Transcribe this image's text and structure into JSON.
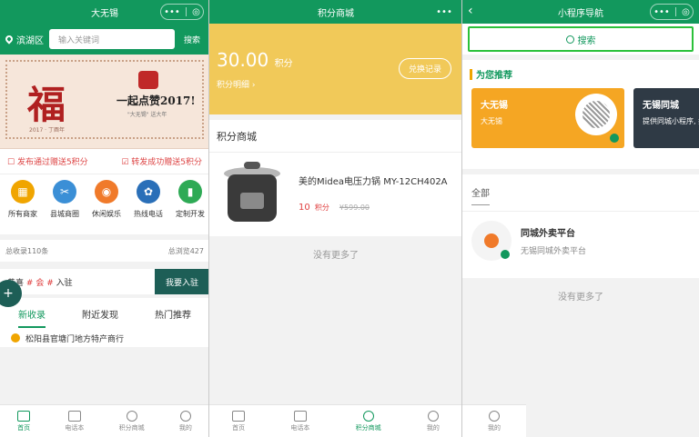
{
  "panel1": {
    "title": "大无锡",
    "location": "滨湖区",
    "search_placeholder": "输入关键词",
    "search_button": "搜索",
    "banner": {
      "fu": "福",
      "fu_sub": "2017 · 丁酉年",
      "slogan": "一起点赞2017!",
      "slogan_sub": "\"大无锡\" 送大年"
    },
    "promo_left": "发布通过赠送5积分",
    "promo_right": "转发成功赠送5积分",
    "categories": [
      {
        "label": "所有商家",
        "color": "#f0a500",
        "glyph": "▦"
      },
      {
        "label": "县城商圈",
        "color": "#3b8fd6",
        "glyph": "✂"
      },
      {
        "label": "休闲娱乐",
        "color": "#f07a2a",
        "glyph": "◉"
      },
      {
        "label": "热线电话",
        "color": "#2a6fb8",
        "glyph": "✿"
      },
      {
        "label": "定制开发",
        "color": "#2eaa55",
        "glyph": "▮"
      }
    ],
    "stats_left": "总收录110条",
    "stats_right": "总浏览427",
    "announce": {
      "pre": "恭喜",
      "hash1": "#",
      "mid": "会",
      "hash2": "#",
      "post": "入驻"
    },
    "announce_button": "我要入驻",
    "tabs": [
      "新收录",
      "附近发现",
      "热门推荐"
    ],
    "list_peek": "松阳县官塘门地方特产商行",
    "tabbar": [
      "首页",
      "电话本",
      "积分商城",
      "我的"
    ]
  },
  "panel2": {
    "title": "积分商城",
    "points_value": "30.00",
    "points_unit": "积分",
    "points_detail": "积分明细",
    "exchange_button": "兑换记录",
    "mall_title": "积分商城",
    "product": {
      "name": "美的Midea电压力锅 MY-12CH402A",
      "price": "10",
      "price_unit": "积分",
      "original": "¥599.00"
    },
    "no_more": "没有更多了",
    "tabbar": [
      "首页",
      "电话本",
      "积分商城",
      "我的"
    ]
  },
  "panel3": {
    "title": "小程序导航",
    "search": "搜索",
    "rec_title": "为您推荐",
    "rec_cards": [
      {
        "name": "大无锡",
        "desc": "大无锡"
      },
      {
        "name": "无锡同城",
        "desc": "提供同城小程序, 拼团, 维修, 电"
      }
    ],
    "all_tab": "全部",
    "app": {
      "name": "同城外卖平台",
      "desc": "无锡同城外卖平台"
    },
    "no_more": "没有更多了",
    "tabbar_item": "我的"
  }
}
